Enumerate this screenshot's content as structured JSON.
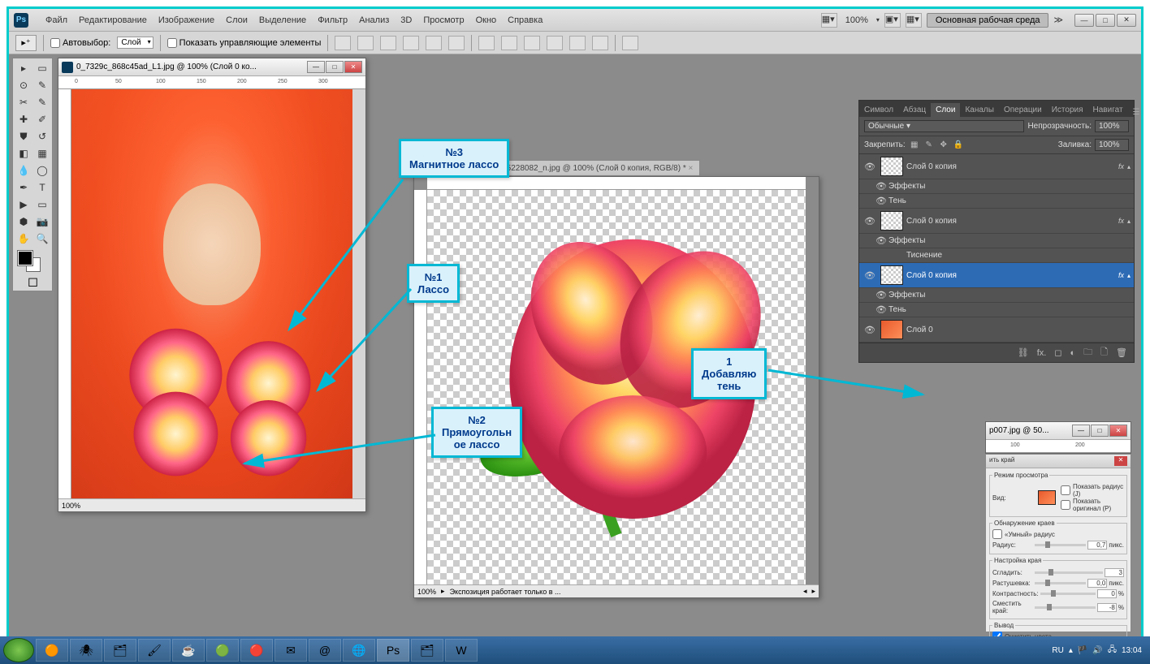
{
  "menu": {
    "file": "Файл",
    "edit": "Редактирование",
    "image": "Изображение",
    "layer": "Слои",
    "select": "Выделение",
    "filter": "Фильтр",
    "analysis": "Анализ",
    "3d": "3D",
    "view": "Просмотр",
    "window": "Окно",
    "help": "Справка"
  },
  "zoom_pct": "100%",
  "workspace_btn": "Основная рабочая среда",
  "options": {
    "autoselect": "Автовыбор:",
    "autosel_target": "Слой",
    "show_transform": "Показать управляющие элементы"
  },
  "doc1": {
    "title": "0_7329c_868c45ad_L1.jpg @ 100% (Слой 0 ко...",
    "zoom": "100%"
  },
  "doc2_tab": "9530651_308810479005228082_n.jpg @ 100% (Слой 0 копия, RGB/8) *",
  "doc2": {
    "zoom": "100%",
    "status": "Экспозиция работает только в ..."
  },
  "doc3": {
    "title": "p007.jpg @ 50..."
  },
  "panels": {
    "tabs": {
      "symbol": "Символ",
      "paragraph": "Абзац",
      "layers": "Слои",
      "channels": "Каналы",
      "actions": "Операции",
      "history": "История",
      "navigator": "Навигат"
    },
    "blend_mode": "Обычные",
    "opacity_label": "Непрозрачность:",
    "opacity": "100%",
    "lock_label": "Закрепить:",
    "fill_label": "Заливка:",
    "fill": "100%",
    "layers": [
      {
        "name": "Слой 0 копия",
        "fx": true,
        "effects_label": "Эффекты",
        "sub": [
          "Тень"
        ]
      },
      {
        "name": "Слой 0 копия",
        "fx": true,
        "effects_label": "Эффекты",
        "sub": [
          "Тиснение"
        ]
      },
      {
        "name": "Слой 0 копия",
        "fx": true,
        "effects_label": "Эффекты",
        "sub": [
          "Тень"
        ],
        "selected": true
      },
      {
        "name": "Слой 0",
        "fx": false
      }
    ]
  },
  "callouts": {
    "c3": "№3\nМагнитное лассо",
    "c1": "№1\nЛассо",
    "c2": "№2\nПрямоугольн\nое лассо",
    "c4": "1\nДобавляю\nтень"
  },
  "refine": {
    "title": "ить край",
    "view_mode": "Режим просмотра",
    "view": "Вид:",
    "show_radius": "Показать радиус (J)",
    "show_original": "Показать оригинал (P)",
    "edge_detect": "Обнаружение краев",
    "smart_radius": "«Умный» радиус",
    "radius": "Радиус:",
    "radius_val": "0,7",
    "px": "пикс.",
    "adjust": "Настройка края",
    "smooth": "Сгладить:",
    "smooth_val": "3",
    "feather": "Растушевка:",
    "feather_val": "0,0",
    "contrast": "Контрастность:",
    "contrast_val": "0",
    "pct": "%",
    "shift": "Сместить край:",
    "shift_val": "-8",
    "output": "Вывод",
    "decon": "Очистить цвета"
  },
  "taskbar": {
    "lang": "RU",
    "time": "13:04"
  }
}
